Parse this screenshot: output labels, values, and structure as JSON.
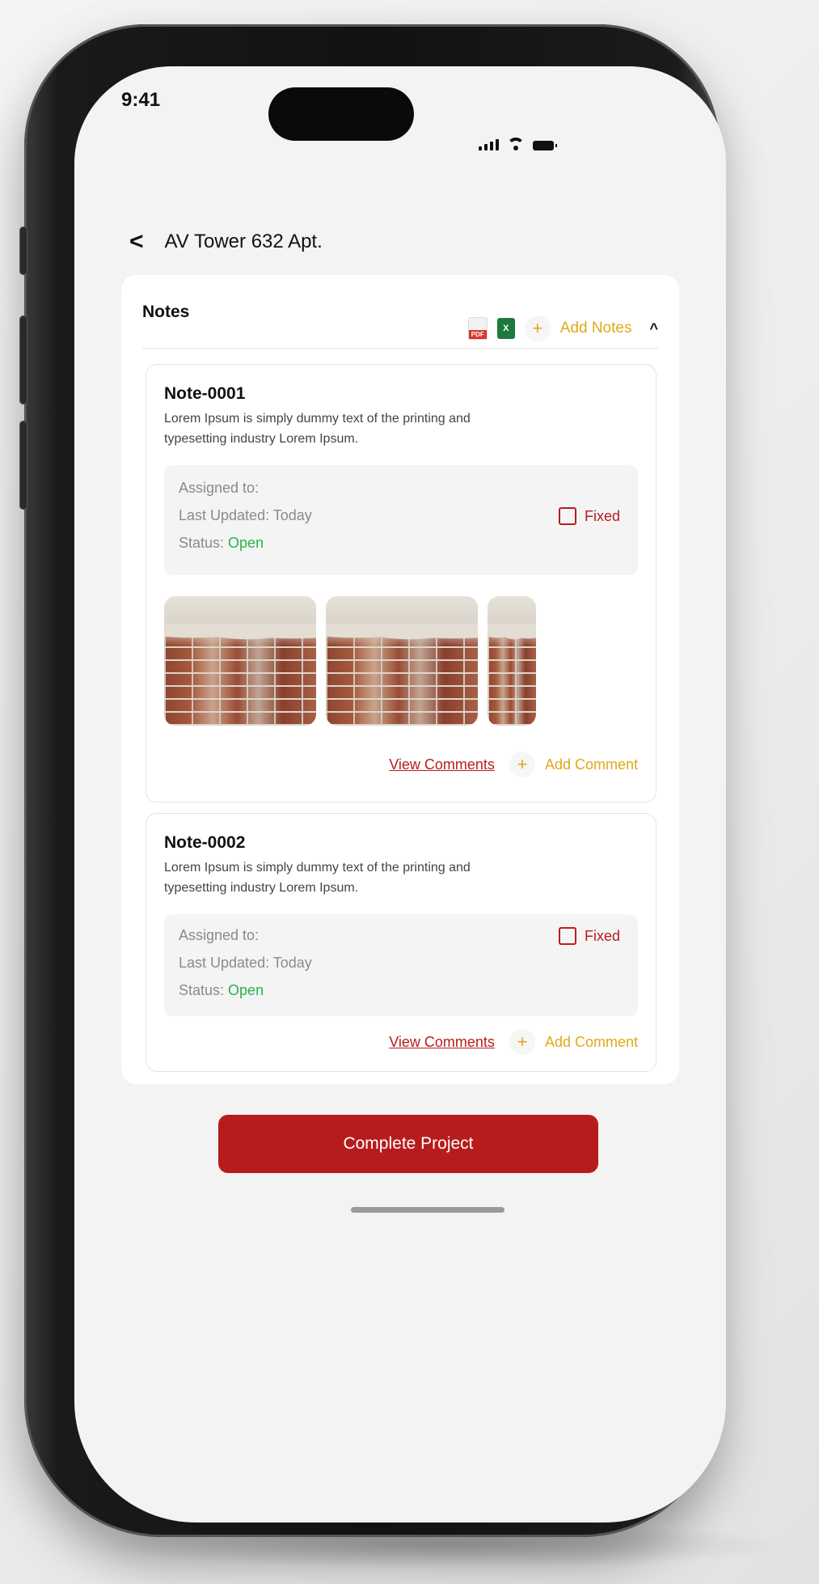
{
  "status_bar": {
    "time": "9:41"
  },
  "header": {
    "back_glyph": "<",
    "title": "AV Tower 632 Apt."
  },
  "notes_panel": {
    "label": "Notes",
    "pdf_badge": "PDF",
    "xls_badge": "X",
    "add_glyph": "+",
    "add_notes_label": "Add Notes",
    "collapse_glyph": "^"
  },
  "notes": [
    {
      "title": "Note-0001",
      "description": "Lorem Ipsum is simply dummy text of the printing and typesetting industry Lorem Ipsum.",
      "assigned_label": "Assigned to:",
      "last_updated": "Last Updated: Today",
      "status_label": "Status:",
      "status_value": "Open",
      "fixed_label": "Fixed",
      "view_comments": "View Comments",
      "add_comment": "Add Comment"
    },
    {
      "title": "Note-0002",
      "description": "Lorem Ipsum is simply dummy text of the printing and typesetting industry Lorem Ipsum.",
      "assigned_label": "Assigned to:",
      "last_updated": "Last Updated: Today",
      "status_label": "Status:",
      "status_value": "Open",
      "fixed_label": "Fixed",
      "view_comments": "View Comments",
      "add_comment": "Add Comment"
    }
  ],
  "footer": {
    "complete_button": "Complete Project"
  },
  "colors": {
    "primary_red": "#b71c1c",
    "accent_gold": "#e1a919",
    "status_green": "#26b34a"
  }
}
